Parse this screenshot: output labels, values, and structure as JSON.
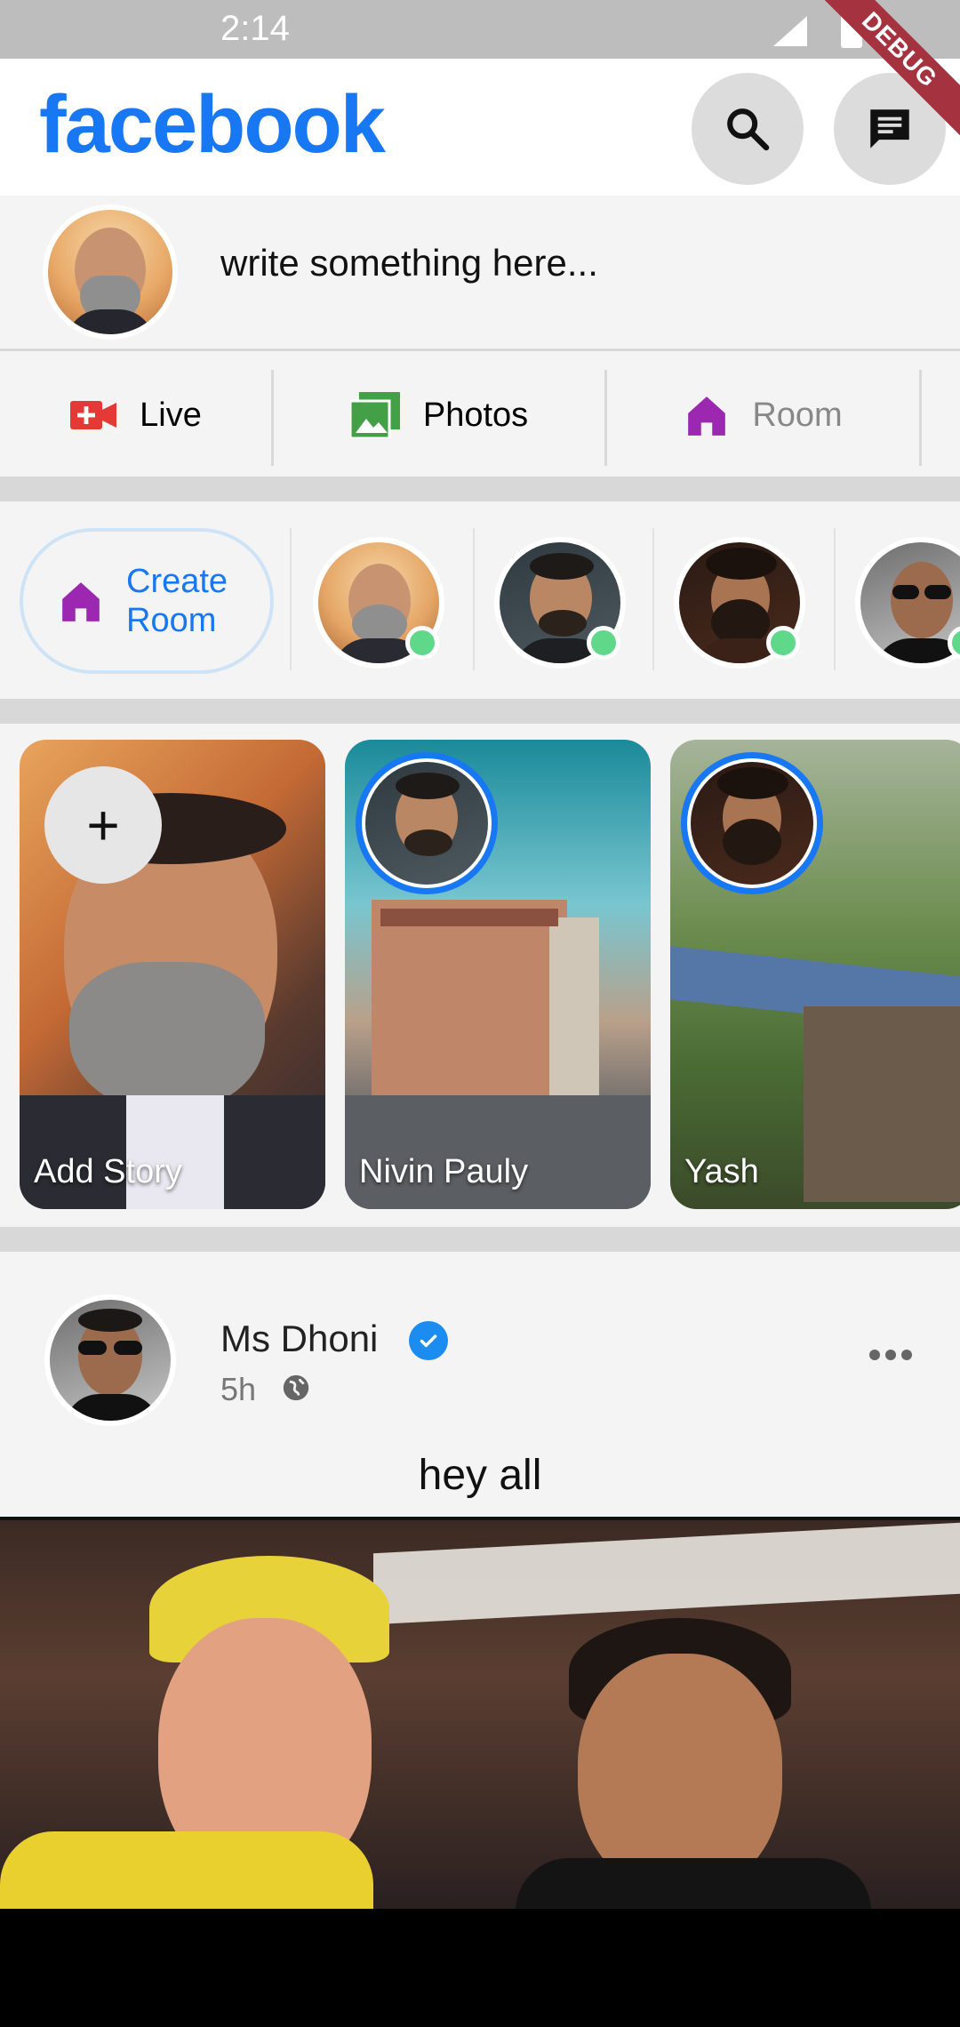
{
  "status_bar": {
    "time": "2:14",
    "debug_banner": "DEBUG"
  },
  "app_bar": {
    "logo": "facebook",
    "icons": [
      "search-icon",
      "messenger-icon"
    ]
  },
  "composer": {
    "placeholder": "write something here...",
    "avatar": "profile-avatar"
  },
  "actions": [
    {
      "label": "Live",
      "icon": "video-icon",
      "color": "#e53935"
    },
    {
      "label": "Photos",
      "icon": "photo-icon",
      "color": "#43a047"
    },
    {
      "label": "Room",
      "icon": "room-icon",
      "color": "#9c27b0"
    }
  ],
  "rooms": {
    "create_label_1": "Create",
    "create_label_2": "Room",
    "online_color": "#5fd88a"
  },
  "stories": {
    "add_label": "Add Story",
    "add_symbol": "+",
    "items": [
      {
        "name": "Nivin Pauly"
      },
      {
        "name": "Yash"
      }
    ]
  },
  "post": {
    "author": "Ms Dhoni",
    "time": "5h",
    "caption": "hey all"
  },
  "colors": {
    "brand": "#1877f2",
    "background": "#f4f4f4",
    "divider": "#d8d8d8"
  }
}
